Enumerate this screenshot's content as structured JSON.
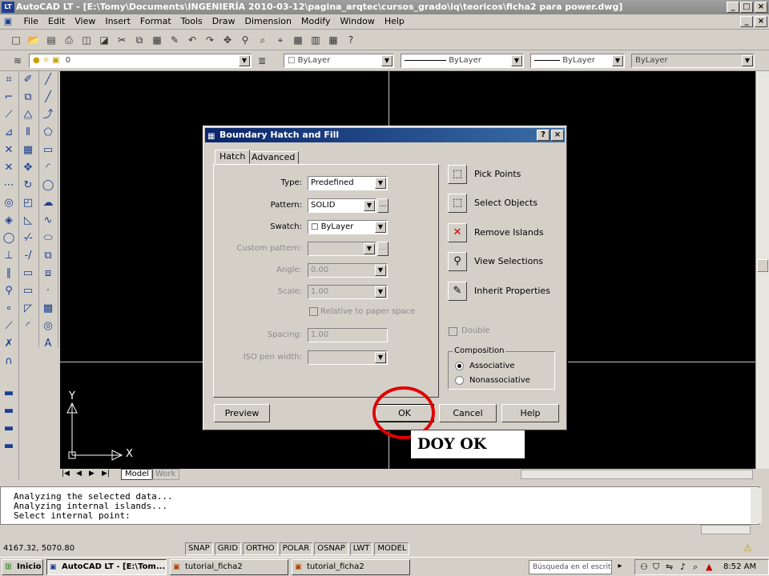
{
  "window": {
    "title": "AutoCAD LT - [E:\\Tomy\\Documents\\INGENIERÍA 2010-03-12\\pagina_arqtec\\cursos_grado\\iq\\teoricos\\ficha2 para power.dwg]",
    "badge": "LT"
  },
  "menu": [
    "File",
    "Edit",
    "View",
    "Insert",
    "Format",
    "Tools",
    "Draw",
    "Dimension",
    "Modify",
    "Window",
    "Help"
  ],
  "layer_toolbar": {
    "layer_value": "0",
    "color_value": "ByLayer",
    "linetype_value": "ByLayer",
    "lineweight_value": "ByLayer",
    "plotstyle_value": "ByLayer"
  },
  "layout_tabs": [
    "Model",
    "Work"
  ],
  "dialog": {
    "title": "Boundary Hatch and Fill",
    "tabs": [
      "Hatch",
      "Advanced"
    ],
    "fields": {
      "type_label": "Type:",
      "type_value": "Predefined",
      "pattern_label": "Pattern:",
      "pattern_value": "SOLID",
      "swatch_label": "Swatch:",
      "swatch_value": "ByLayer",
      "custom_label": "Custom pattern:",
      "custom_value": "",
      "angle_label": "Angle:",
      "angle_value": "0.00",
      "scale_label": "Scale:",
      "scale_value": "1.00",
      "relative_label": "Relative to paper space",
      "spacing_label": "Spacing:",
      "spacing_value": "1.00",
      "iso_label": "ISO pen width:",
      "iso_value": ""
    },
    "side_buttons": [
      "Pick Points",
      "Select Objects",
      "Remove Islands",
      "View Selections",
      "Inherit Properties"
    ],
    "double_label": "Double",
    "composition": {
      "legend": "Composition",
      "options": [
        "Associative",
        "Nonassociative"
      ]
    },
    "buttons": {
      "preview": "Preview",
      "ok": "OK",
      "cancel": "Cancel",
      "help": "Help"
    }
  },
  "annotation": {
    "text": "DOY OK",
    "circle_color": "#e00000"
  },
  "axes": {
    "y": "Y",
    "x": "X"
  },
  "command_lines": [
    "Analyzing the selected data...",
    "Analyzing internal islands...",
    "Select internal point:"
  ],
  "status": {
    "coords": "4167.32, 5070.80",
    "toggles": [
      "SNAP",
      "GRID",
      "ORTHO",
      "POLAR",
      "OSNAP",
      "LWT",
      "MODEL"
    ]
  },
  "taskbar": {
    "start": "Inicio",
    "tasks": [
      "AutoCAD LT - [E:\\Tom...",
      "tutorial_ficha2",
      "tutorial_ficha2"
    ],
    "search_placeholder": "Búsqueda en el escrit",
    "clock": "8:52 AM"
  }
}
